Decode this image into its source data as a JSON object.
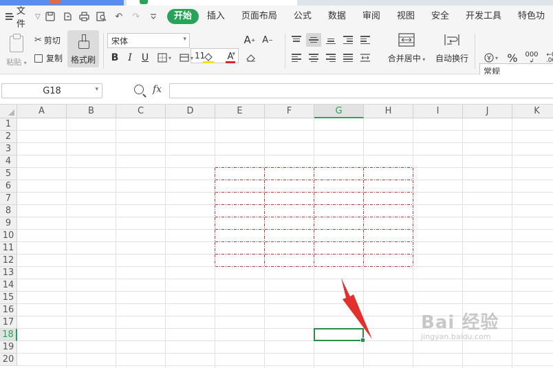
{
  "menubar": {
    "file_label": "文件",
    "tabs": [
      {
        "label": "开始",
        "active": true
      },
      {
        "label": "插入",
        "active": false
      },
      {
        "label": "页面布局",
        "active": false
      },
      {
        "label": "公式",
        "active": false
      },
      {
        "label": "数据",
        "active": false
      },
      {
        "label": "审阅",
        "active": false
      },
      {
        "label": "视图",
        "active": false
      },
      {
        "label": "安全",
        "active": false
      },
      {
        "label": "开发工具",
        "active": false
      },
      {
        "label": "特色功",
        "active": false
      }
    ]
  },
  "ribbon": {
    "paste_label": "粘贴",
    "cut_label": "剪切",
    "copy_label": "复制",
    "format_painter_label": "格式刷",
    "font_name": "宋体",
    "font_size": "11",
    "bold": "B",
    "italic": "I",
    "underline": "U",
    "merge_center_label": "合并居中",
    "wrap_text_label": "自动换行",
    "number_format": "常规",
    "percent": "%"
  },
  "formulabar": {
    "name_box": "G18",
    "fx_label": "fx",
    "formula_value": ""
  },
  "sheet": {
    "columns": [
      "A",
      "B",
      "C",
      "D",
      "E",
      "F",
      "G",
      "H",
      "I",
      "J",
      "K"
    ],
    "rows": [
      "1",
      "2",
      "3",
      "4",
      "5",
      "6",
      "7",
      "8",
      "9",
      "10",
      "11",
      "12",
      "13",
      "14",
      "15",
      "16",
      "17",
      "18",
      "19",
      "20"
    ],
    "active_column": "G",
    "active_row": "18",
    "dashed_border_range": "E5:H12",
    "dashed_border_color": "#b03a3a",
    "selection_color": "#2a8d45",
    "arrow_color": "#e2312d"
  },
  "watermark": {
    "main": "Bai 经验",
    "sub": "jingyan.baidu.com"
  },
  "colors": {
    "accent": "#27a45a"
  }
}
